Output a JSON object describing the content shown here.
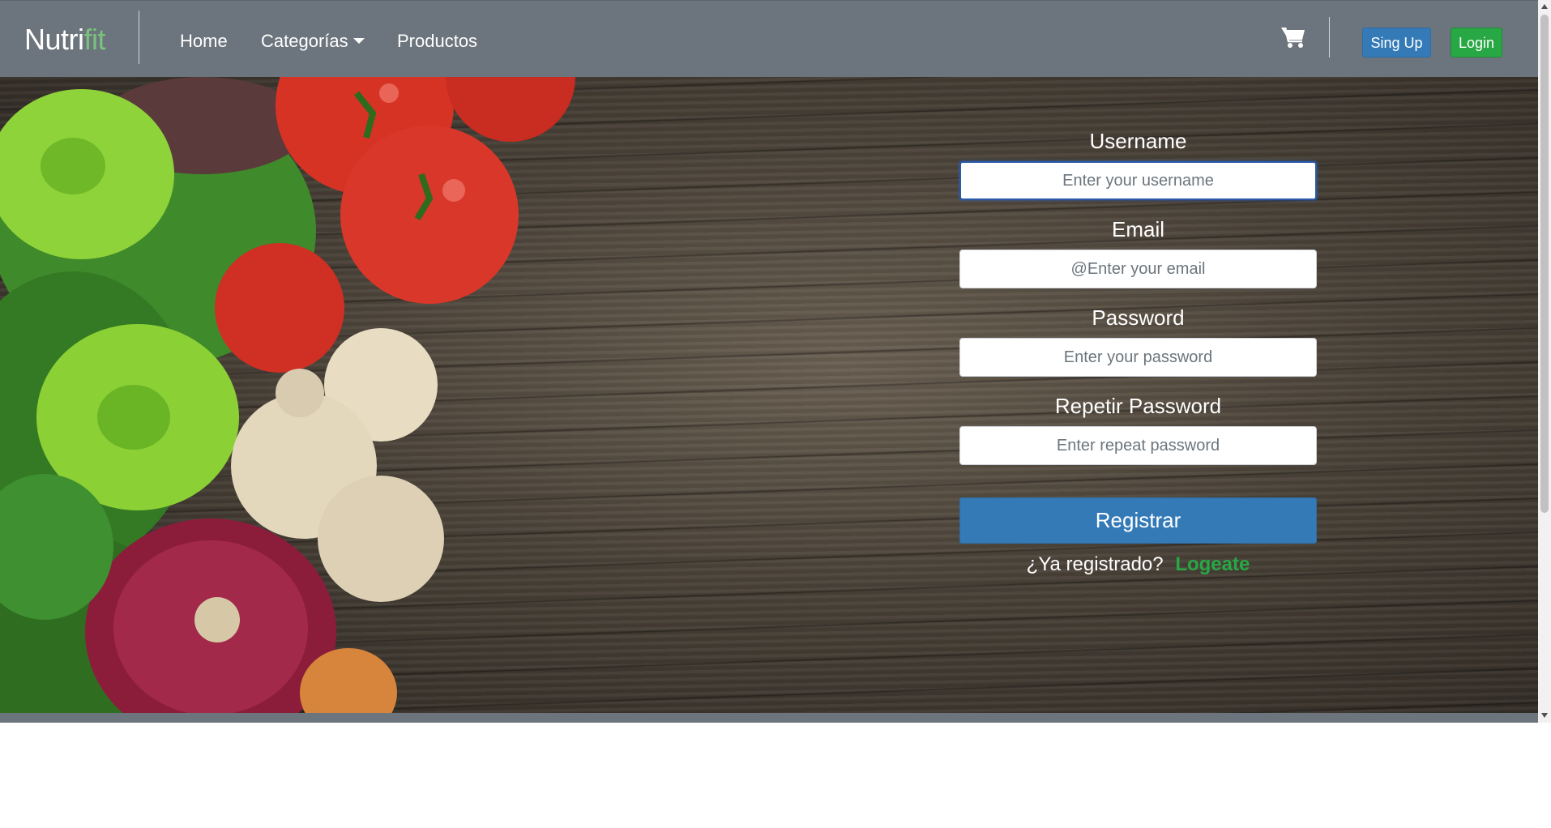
{
  "brand": {
    "prefix": "Nutri",
    "accent": "fit"
  },
  "nav": {
    "home": "Home",
    "categories": "Categorías",
    "products": "Productos",
    "signup": "Sing Up",
    "login": "Login"
  },
  "form": {
    "username": {
      "label": "Username",
      "placeholder": "Enter your username"
    },
    "email": {
      "label": "Email",
      "placeholder": "@Enter your email"
    },
    "password": {
      "label": "Password",
      "placeholder": "Enter your password"
    },
    "repeat": {
      "label": "Repetir Password",
      "placeholder": "Enter repeat password"
    },
    "submit": "Registrar",
    "already": "¿Ya registrado?",
    "login_link": "Logeate"
  },
  "colors": {
    "navbar": "#6c757d",
    "brand_accent": "#79c27c",
    "primary": "#337ab7",
    "success": "#28a745"
  },
  "icons": {
    "cart": "shopping-cart-icon",
    "dropdown": "caret-down-icon"
  }
}
